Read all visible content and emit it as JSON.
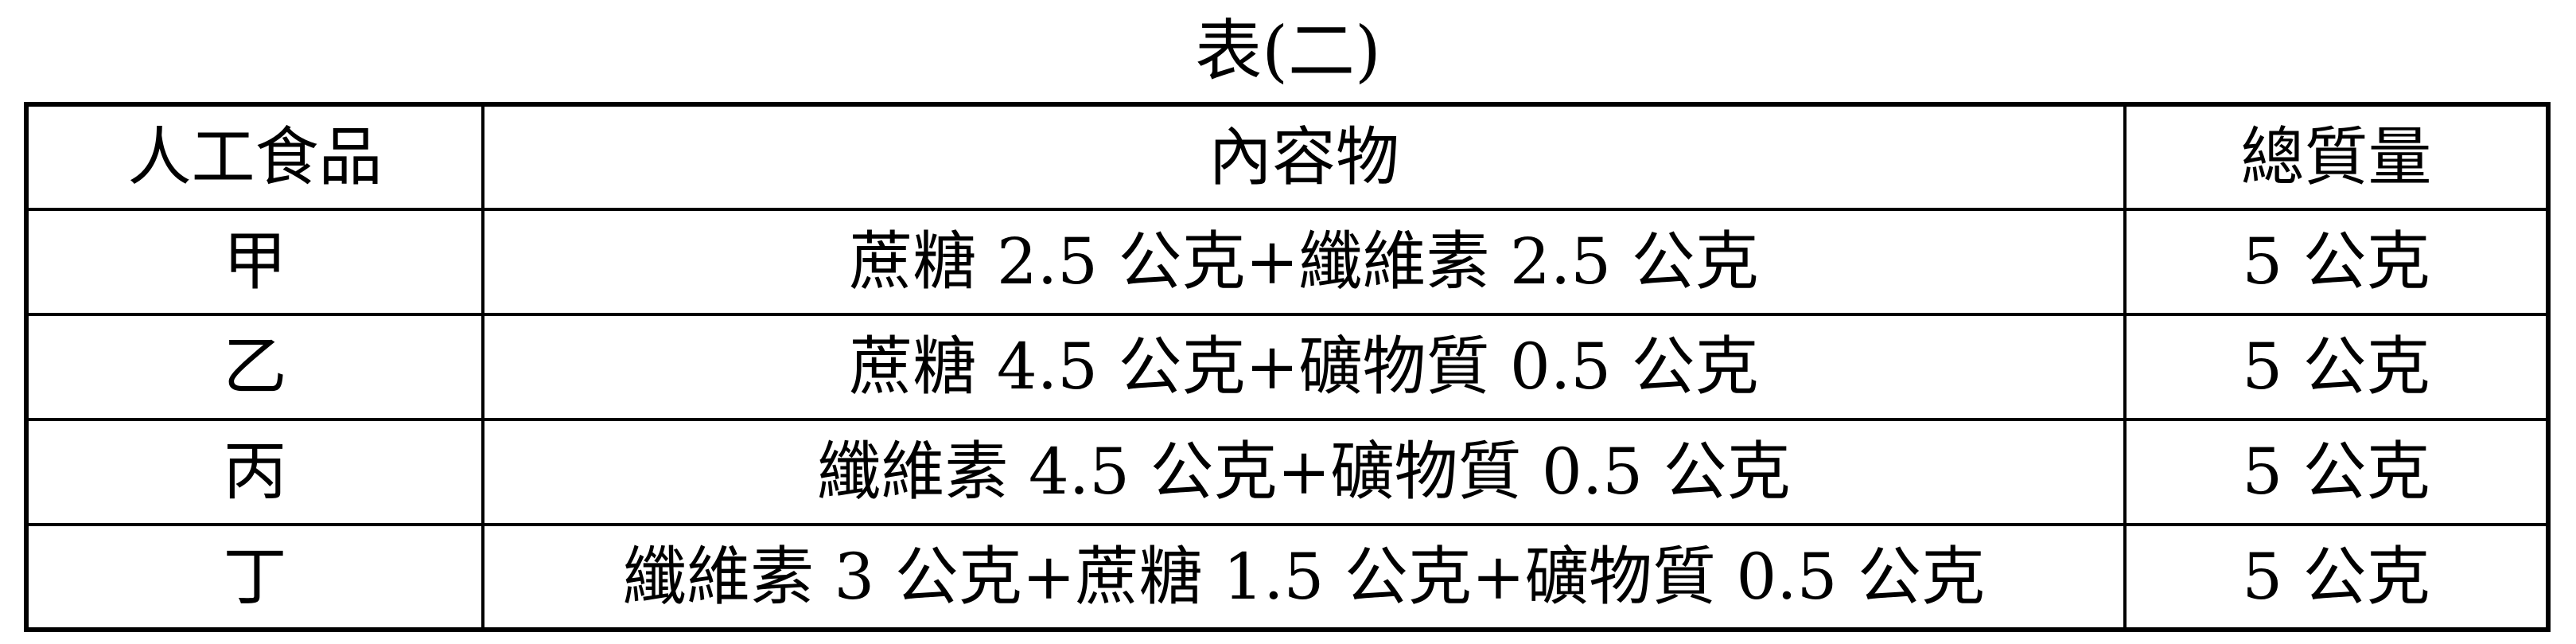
{
  "caption": "表(二)",
  "table": {
    "headers": [
      "人工食品",
      "內容物",
      "總質量"
    ],
    "rows": [
      {
        "food": "甲",
        "contents": "蔗糖 2.5 公克+纖維素 2.5 公克",
        "total": "5 公克"
      },
      {
        "food": "乙",
        "contents": "蔗糖 4.5 公克+礦物質 0.5 公克",
        "total": "5 公克"
      },
      {
        "food": "丙",
        "contents": "纖維素 4.5 公克+礦物質 0.5 公克",
        "total": "5 公克"
      },
      {
        "food": "丁",
        "contents": "纖維素 3 公克+蔗糖 1.5 公克+礦物質 0.5 公克",
        "total": "5 公克"
      }
    ]
  }
}
